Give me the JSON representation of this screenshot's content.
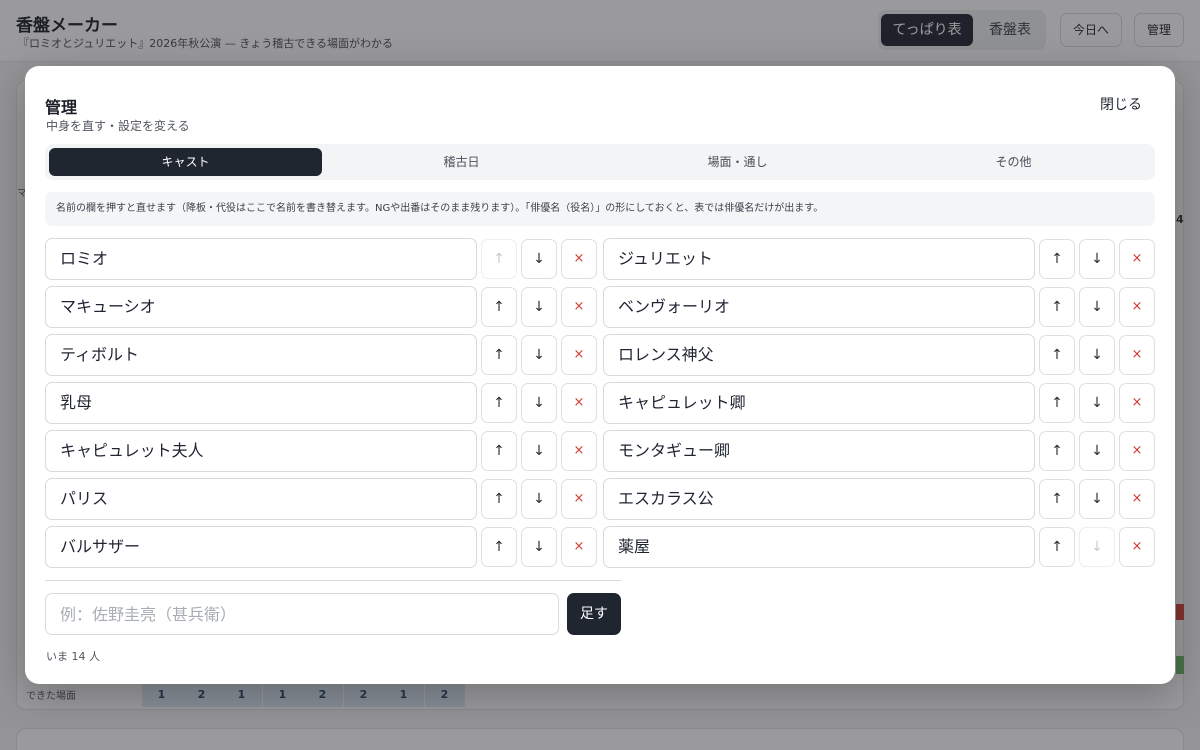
{
  "app": {
    "title": "香盤メーカー",
    "subtitle": "『ロミオとジュリエット』2026年秋公演 — きょう稽古できる場面がわかる",
    "view_tabs": [
      "てっぱり表",
      "香盤表"
    ],
    "today_label": "今日へ",
    "admin_label": "管理"
  },
  "background": {
    "row_label": "できた場面",
    "row_values": [
      "1",
      "2",
      "1",
      "1",
      "2",
      "2",
      "1",
      "2"
    ],
    "edge_number": "4"
  },
  "modal": {
    "title": "管理",
    "subtitle": "中身を直す・設定を変える",
    "close_label": "閉じる",
    "tabs": [
      "キャスト",
      "稽古日",
      "場面・通し",
      "その他"
    ],
    "active_tab": "キャスト",
    "note": "名前の欄を押すと直せます（降板・代役はここで名前を書き替えます。NGや出番はそのまま残ります）。「俳優名（役名）」の形にしておくと、表では俳優名だけが出ます。",
    "cast": [
      {
        "name": "ロミオ"
      },
      {
        "name": "ジュリエット"
      },
      {
        "name": "マキューシオ"
      },
      {
        "name": "ベンヴォーリオ"
      },
      {
        "name": "ティボルト"
      },
      {
        "name": "ロレンス神父"
      },
      {
        "name": "乳母"
      },
      {
        "name": "キャピュレット卿"
      },
      {
        "name": "キャピュレット夫人"
      },
      {
        "name": "モンタギュー卿"
      },
      {
        "name": "パリス"
      },
      {
        "name": "エスカラス公"
      },
      {
        "name": "バルサザー"
      },
      {
        "name": "薬屋"
      }
    ],
    "icons": {
      "up": "↑",
      "down": "↓",
      "delete": "×"
    },
    "add_placeholder": "例：佐野圭亮（甚兵衛）",
    "add_label": "足す",
    "count_text": "いま 14 人"
  }
}
